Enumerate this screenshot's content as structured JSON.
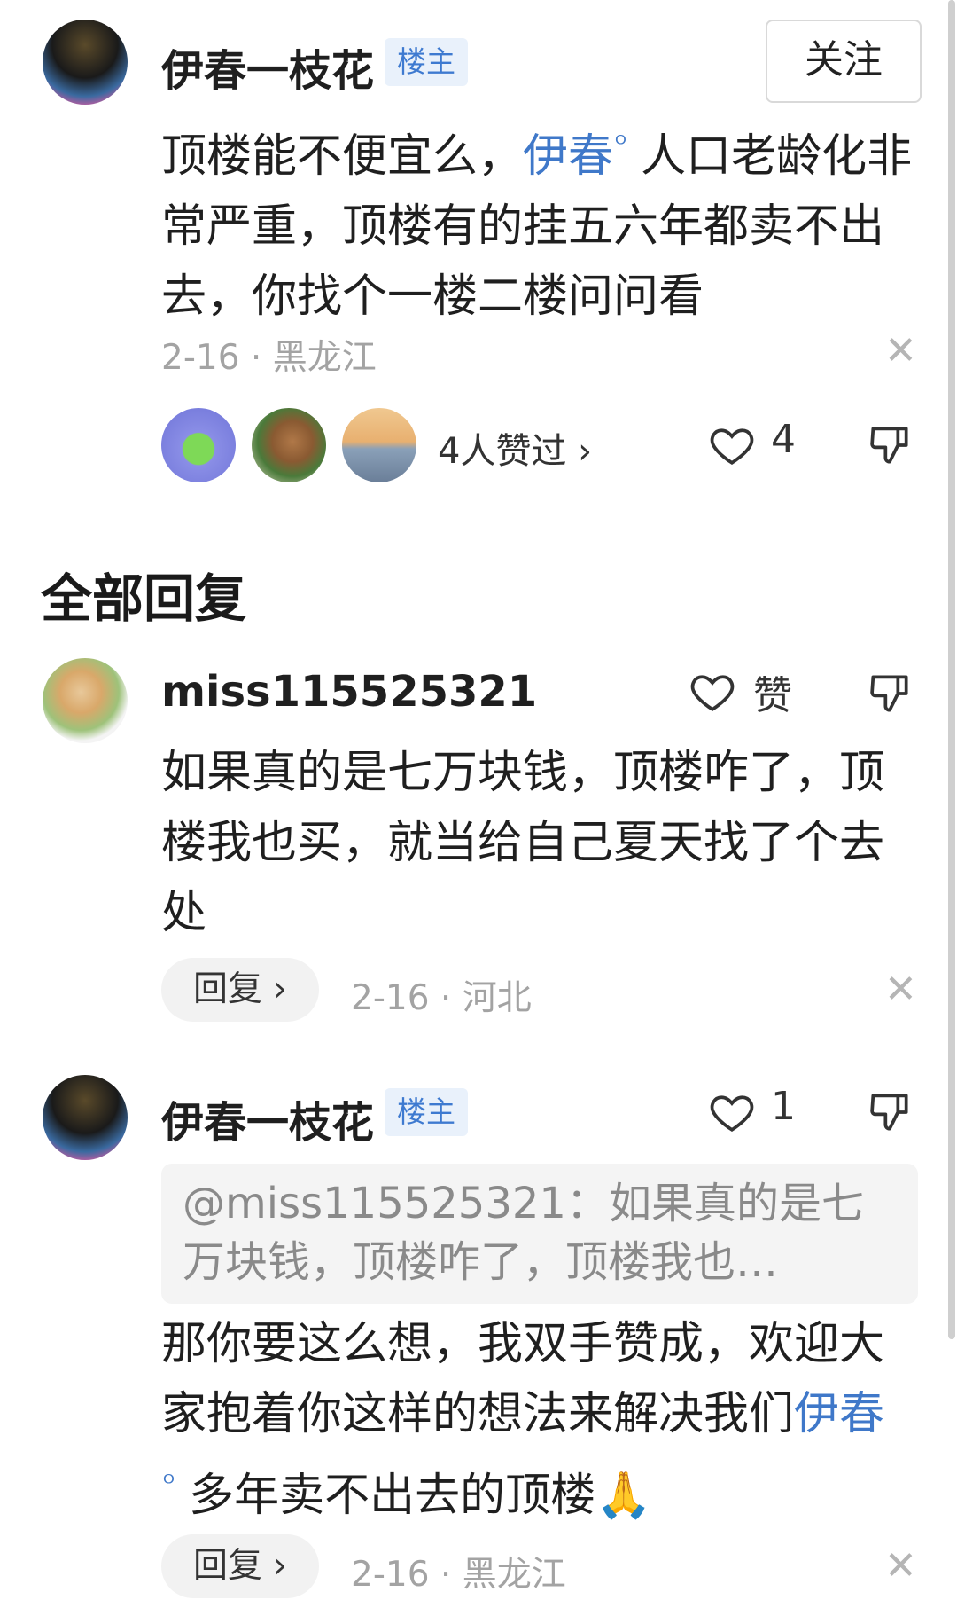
{
  "post": {
    "author": "伊春一枝花",
    "badge": "楼主",
    "follow_label": "关注",
    "text_before": "顶楼能不便宜么，",
    "link": "伊春",
    "text_after": " 人口老龄化非常严重，顶楼有的挂五六年都卖不出去，你找个一楼二楼问问看",
    "meta": "2-16 · 黑龙江",
    "likers_label": "4人赞过 ›",
    "like_count": "4"
  },
  "section_title": "全部回复",
  "replies": [
    {
      "author": "miss115525321",
      "like_label": "赞",
      "text": "如果真的是七万块钱，顶楼咋了，顶楼我也买，就当给自己夏天找了个去处",
      "reply_label": "回复 ›",
      "meta": "2-16 · 河北"
    },
    {
      "author": "伊春一枝花",
      "badge": "楼主",
      "like_count": "1",
      "quote": "@miss115525321：如果真的是七万块钱，顶楼咋了，顶楼我也…",
      "text_before": "那你要这么想，我双手赞成，欢迎大家抱着你这样的想法来解决我们",
      "link": "伊春",
      "text_after": " 多年卖不出去的顶楼",
      "emoji": "🙏",
      "reply_label": "回复 ›",
      "meta": "2-16 · 黑龙江"
    }
  ],
  "icons": [
    "heart-icon",
    "thumbs-down-icon",
    "close-icon",
    "link-pin-icon"
  ],
  "colors": {
    "link": "#3f78c9",
    "badge_bg": "#e9f1fb",
    "badge_text": "#3e7ad0",
    "meta": "#a3a3a3"
  }
}
